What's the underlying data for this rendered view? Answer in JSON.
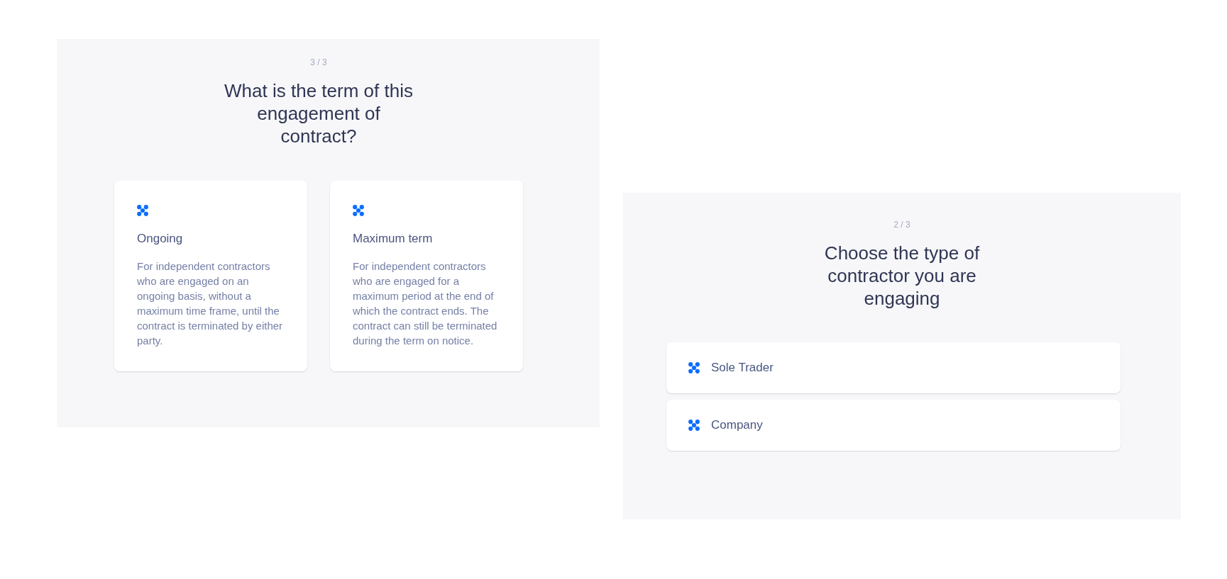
{
  "panels": [
    {
      "kind": "cards",
      "step": "3 / 3",
      "title": "What is the term of this engagement of contract?",
      "options": [
        {
          "label": "Ongoing",
          "description": "For independent contractors who are engaged on an ongoing basis, without a maximum time frame, until the contract is terminated by either party."
        },
        {
          "label": "Maximum term",
          "description": "For independent contractors who are engaged for a maximum period at the end of which the contract ends. The contract can still be terminated during the term on notice."
        }
      ]
    },
    {
      "kind": "list",
      "step": "2 / 3",
      "title": "Choose the type of contractor you are engaging",
      "options": [
        {
          "label": "Sole Trader"
        },
        {
          "label": "Company"
        }
      ]
    }
  ]
}
